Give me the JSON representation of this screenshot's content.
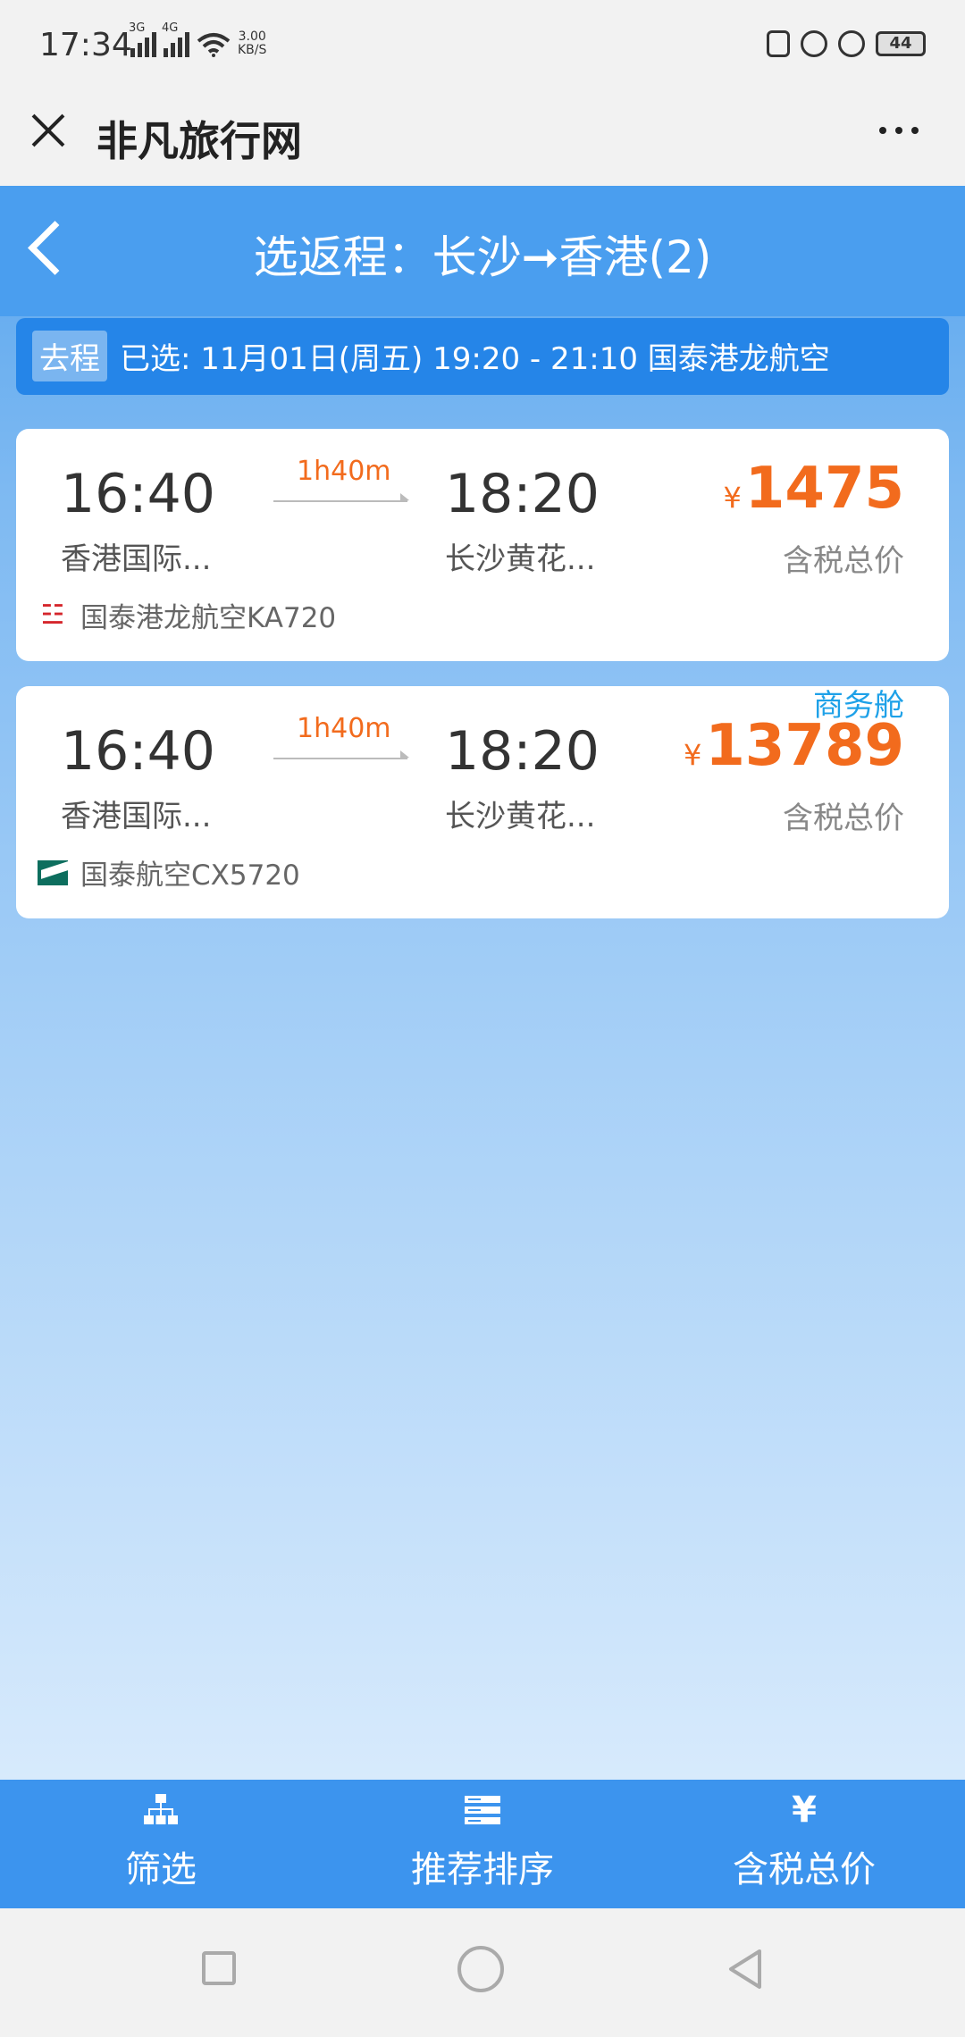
{
  "status_bar": {
    "time": "17:34",
    "net_3g": "3G",
    "net_4g": "4G",
    "speed_value": "3.00",
    "speed_unit": "KB/S",
    "battery": "44"
  },
  "appbar": {
    "title": "非凡旅行网"
  },
  "header": {
    "title": "选返程：长沙➞香港(2)"
  },
  "selected_outbound": {
    "tag": "去程",
    "text": "已选: 11月01日(周五) 19:20 - 21:10  国泰港龙航空"
  },
  "flights": [
    {
      "dep_time": "16:40",
      "arr_time": "18:20",
      "duration": "1h40m",
      "dep_airport": "香港国际...",
      "arr_airport": "长沙黄花...",
      "currency": "¥",
      "price": "1475",
      "price_note": "含税总价",
      "cabin": "",
      "airline": "国泰港龙航空KA720",
      "logo_icon": "dragon-logo-icon"
    },
    {
      "dep_time": "16:40",
      "arr_time": "18:20",
      "duration": "1h40m",
      "dep_airport": "香港国际...",
      "arr_airport": "长沙黄花...",
      "currency": "¥",
      "price": "13789",
      "price_note": "含税总价",
      "cabin": "商务舱",
      "airline": "国泰航空CX5720",
      "logo_icon": "cathay-logo-icon"
    }
  ],
  "bottom_tabs": [
    {
      "label": "筛选",
      "icon": "filter-icon"
    },
    {
      "label": "推荐排序",
      "icon": "sort-icon"
    },
    {
      "label": "含税总价",
      "icon": "yen-icon",
      "icon_text": "¥"
    }
  ],
  "colors": {
    "primary_blue": "#4a9eef",
    "price_orange": "#f26b1d",
    "cabin_blue": "#1ea1e8"
  }
}
